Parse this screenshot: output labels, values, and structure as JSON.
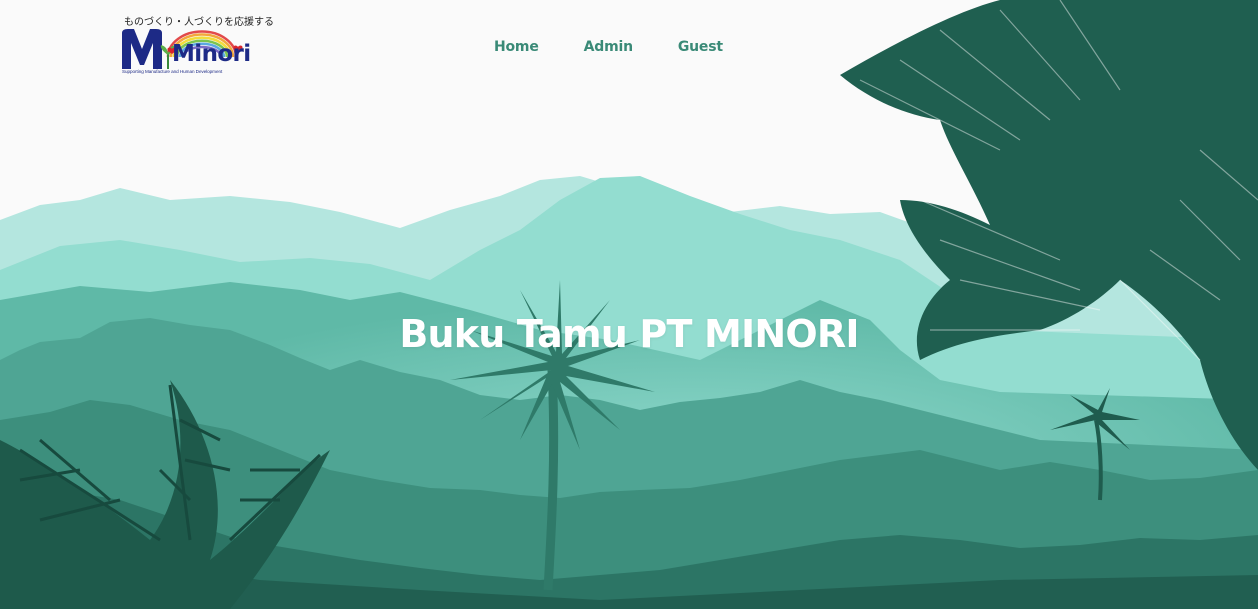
{
  "logo": {
    "tagline_jp": "ものづくり・人づくりを応援する",
    "wordmark": "Minori",
    "tagline_en": "Supporting Manufacture and Human Development"
  },
  "nav": {
    "items": [
      {
        "label": "Home"
      },
      {
        "label": "Admin"
      },
      {
        "label": "Guest"
      }
    ]
  },
  "hero": {
    "title": "Buku Tamu PT MINORI"
  },
  "colors": {
    "nav_text": "#3a8a77",
    "brand_navy": "#1d2a86",
    "background": "#fafafa",
    "sky_mountain": "#b4e6df",
    "teal_mid": "#5fb9a7",
    "forest_dark": "#1d5c4c"
  }
}
